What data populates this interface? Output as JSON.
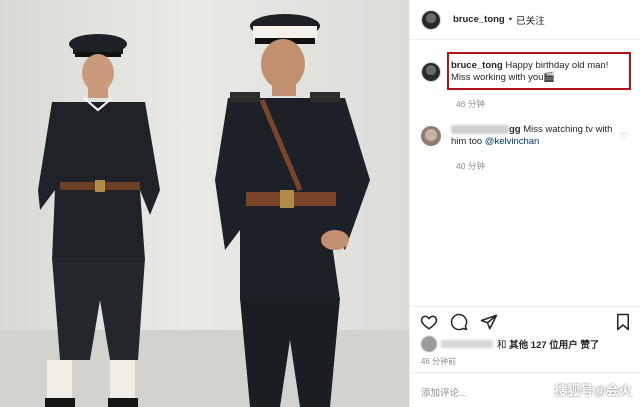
{
  "post": {
    "username": "bruce_tong",
    "separator": "•",
    "follow_status": "已关注"
  },
  "caption": {
    "username": "bruce_tong",
    "text": "Happy birthday old man! Miss working with you🎬",
    "likes": "46 分钟"
  },
  "comment": {
    "username_visible_tail": "gg",
    "text": "Miss watching tv with him too",
    "mention": "@kelvinchan",
    "meta": "40 分钟"
  },
  "likes": {
    "text_prefix": "和",
    "text": "其他 127 位用户 赞了"
  },
  "timestamp": "46 分钟前",
  "add_comment_placeholder": "添加评论...",
  "watermark": "搜狐号@会火",
  "icons": [
    "heart-icon",
    "comment-icon",
    "share-icon",
    "bookmark-icon",
    "small-heart-icon"
  ]
}
